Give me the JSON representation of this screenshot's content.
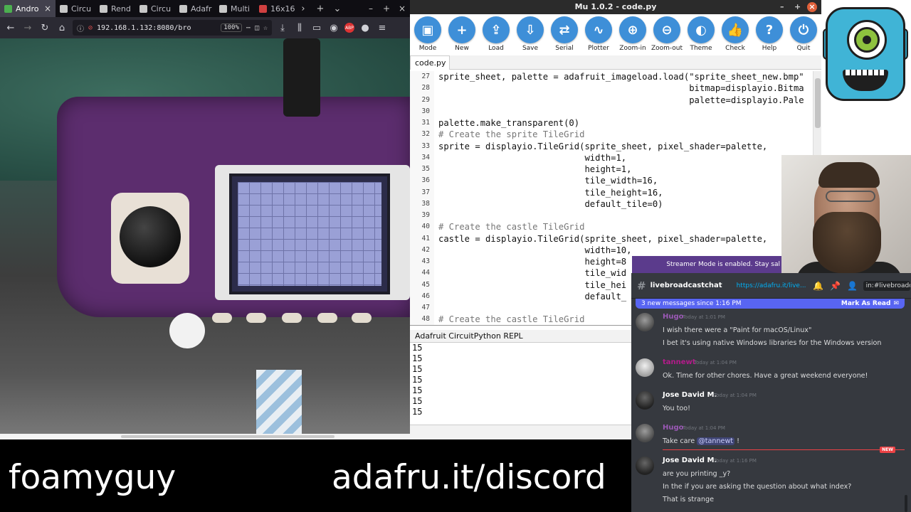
{
  "browser": {
    "tabs": [
      {
        "label": "Andro",
        "fav_color": "#4caf50",
        "active": true
      },
      {
        "label": "Circu",
        "fav_color": "#c7c7c7",
        "active": false
      },
      {
        "label": "Rend",
        "fav_color": "#c7c7c7",
        "active": false
      },
      {
        "label": "Circu",
        "fav_color": "#c7c7c7",
        "active": false
      },
      {
        "label": "Adafr",
        "fav_color": "#c7c7c7",
        "active": false
      },
      {
        "label": "Multi",
        "fav_color": "#c7c7c7",
        "active": false
      },
      {
        "label": "16x16",
        "fav_color": "#d04040",
        "active": false
      }
    ],
    "url": "192.168.1.132:8080/bro",
    "zoom": "100%",
    "addon_badge": "ABP"
  },
  "mu": {
    "window_title": "Mu 1.0.2 - code.py",
    "toolbar": [
      {
        "label": "Mode",
        "icon": "mode-icon",
        "glyph": "▣"
      },
      {
        "label": "New",
        "icon": "plus-icon",
        "glyph": "+"
      },
      {
        "label": "Load",
        "icon": "upload-icon",
        "glyph": "⇪"
      },
      {
        "label": "Save",
        "icon": "download-icon",
        "glyph": "⇩"
      },
      {
        "label": "Serial",
        "icon": "serial-arrows-icon",
        "glyph": "⇄"
      },
      {
        "label": "Plotter",
        "icon": "plotter-wave-icon",
        "glyph": "∿"
      },
      {
        "label": "Zoom-in",
        "icon": "zoom-in-icon",
        "glyph": "⊕"
      },
      {
        "label": "Zoom-out",
        "icon": "zoom-out-icon",
        "glyph": "⊖"
      },
      {
        "label": "Theme",
        "icon": "theme-icon",
        "glyph": "◐"
      },
      {
        "label": "Check",
        "icon": "thumbs-up-icon",
        "glyph": "👍"
      },
      {
        "label": "Help",
        "icon": "help-icon",
        "glyph": "?"
      },
      {
        "label": "Quit",
        "icon": "power-icon",
        "glyph": "⏻"
      }
    ],
    "accent": "#3e8fd8",
    "file_tab": "code.py",
    "code_lines": [
      {
        "n": "27",
        "t": "sprite_sheet, palette = adafruit_imageload.load(\"sprite_sheet_new.bmp\""
      },
      {
        "n": "28",
        "t": "                                                bitmap=displayio.Bitma"
      },
      {
        "n": "29",
        "t": "                                                palette=displayio.Pale"
      },
      {
        "n": "30",
        "t": ""
      },
      {
        "n": "31",
        "t": "palette.make_transparent(0)"
      },
      {
        "n": "32",
        "t": "# Create the sprite TileGrid"
      },
      {
        "n": "33",
        "t": "sprite = displayio.TileGrid(sprite_sheet, pixel_shader=palette,"
      },
      {
        "n": "34",
        "t": "                            width=1,"
      },
      {
        "n": "35",
        "t": "                            height=1,"
      },
      {
        "n": "36",
        "t": "                            tile_width=16,"
      },
      {
        "n": "37",
        "t": "                            tile_height=16,"
      },
      {
        "n": "38",
        "t": "                            default_tile=0)"
      },
      {
        "n": "39",
        "t": ""
      },
      {
        "n": "40",
        "t": "# Create the castle TileGrid"
      },
      {
        "n": "41",
        "t": "castle = displayio.TileGrid(sprite_sheet, pixel_shader=palette,"
      },
      {
        "n": "42",
        "t": "                            width=10,"
      },
      {
        "n": "43",
        "t": "                            height=8"
      },
      {
        "n": "44",
        "t": "                            tile_wid"
      },
      {
        "n": "45",
        "t": "                            tile_hei"
      },
      {
        "n": "46",
        "t": "                            default_"
      },
      {
        "n": "47",
        "t": ""
      },
      {
        "n": "48",
        "t": "# Create the castle TileGrid"
      }
    ],
    "repl_title": "Adafruit CircuitPython REPL",
    "repl_lines": [
      "15",
      "15",
      "15",
      "15",
      "15",
      "15",
      "15"
    ]
  },
  "streamer_banner": "Streamer Mode is enabled. Stay sal",
  "discord": {
    "channel": "livebroadcastchat",
    "topic": "https://adafru.it/live...",
    "search": "in:#livebroadca",
    "new_messages": "3 new messages since 1:16 PM",
    "mark_read": "Mark As Read",
    "new_badge": "NEW",
    "messages": [
      {
        "author": "Hugo",
        "color": "#9b59b6",
        "time": "Today at 1:01 PM",
        "avatar": "mid",
        "lines": [
          "I wish there were a \"Paint for macOS/Linux\"",
          "I bet it's using native Windows libraries for the Windows version"
        ]
      },
      {
        "author": "tannewt",
        "color": "#b31b8a",
        "time": "Today at 1:04 PM",
        "avatar": "light",
        "lines": [
          "Ok. Time for other chores. Have a great weekend everyone!"
        ]
      },
      {
        "author": "Jose David M.",
        "color": "#ffffff",
        "time": "Today at 1:04 PM",
        "avatar": "dark",
        "lines": [
          "You too!"
        ]
      },
      {
        "author": "Hugo",
        "color": "#9b59b6",
        "time": "Today at 1:04 PM",
        "avatar": "mid",
        "lines": [
          "Take care ",
          "@tannewt",
          " !"
        ]
      },
      {
        "author": "Jose David M.",
        "color": "#ffffff",
        "time": "Today at 1:16 PM",
        "avatar": "dark",
        "lines": [
          "are you printing _y?",
          "In the if you are asking the question about what index?",
          "That is strange"
        ]
      }
    ]
  },
  "overlay": {
    "handle": "foamyguy",
    "discord_link": "adafru.it/discord"
  }
}
